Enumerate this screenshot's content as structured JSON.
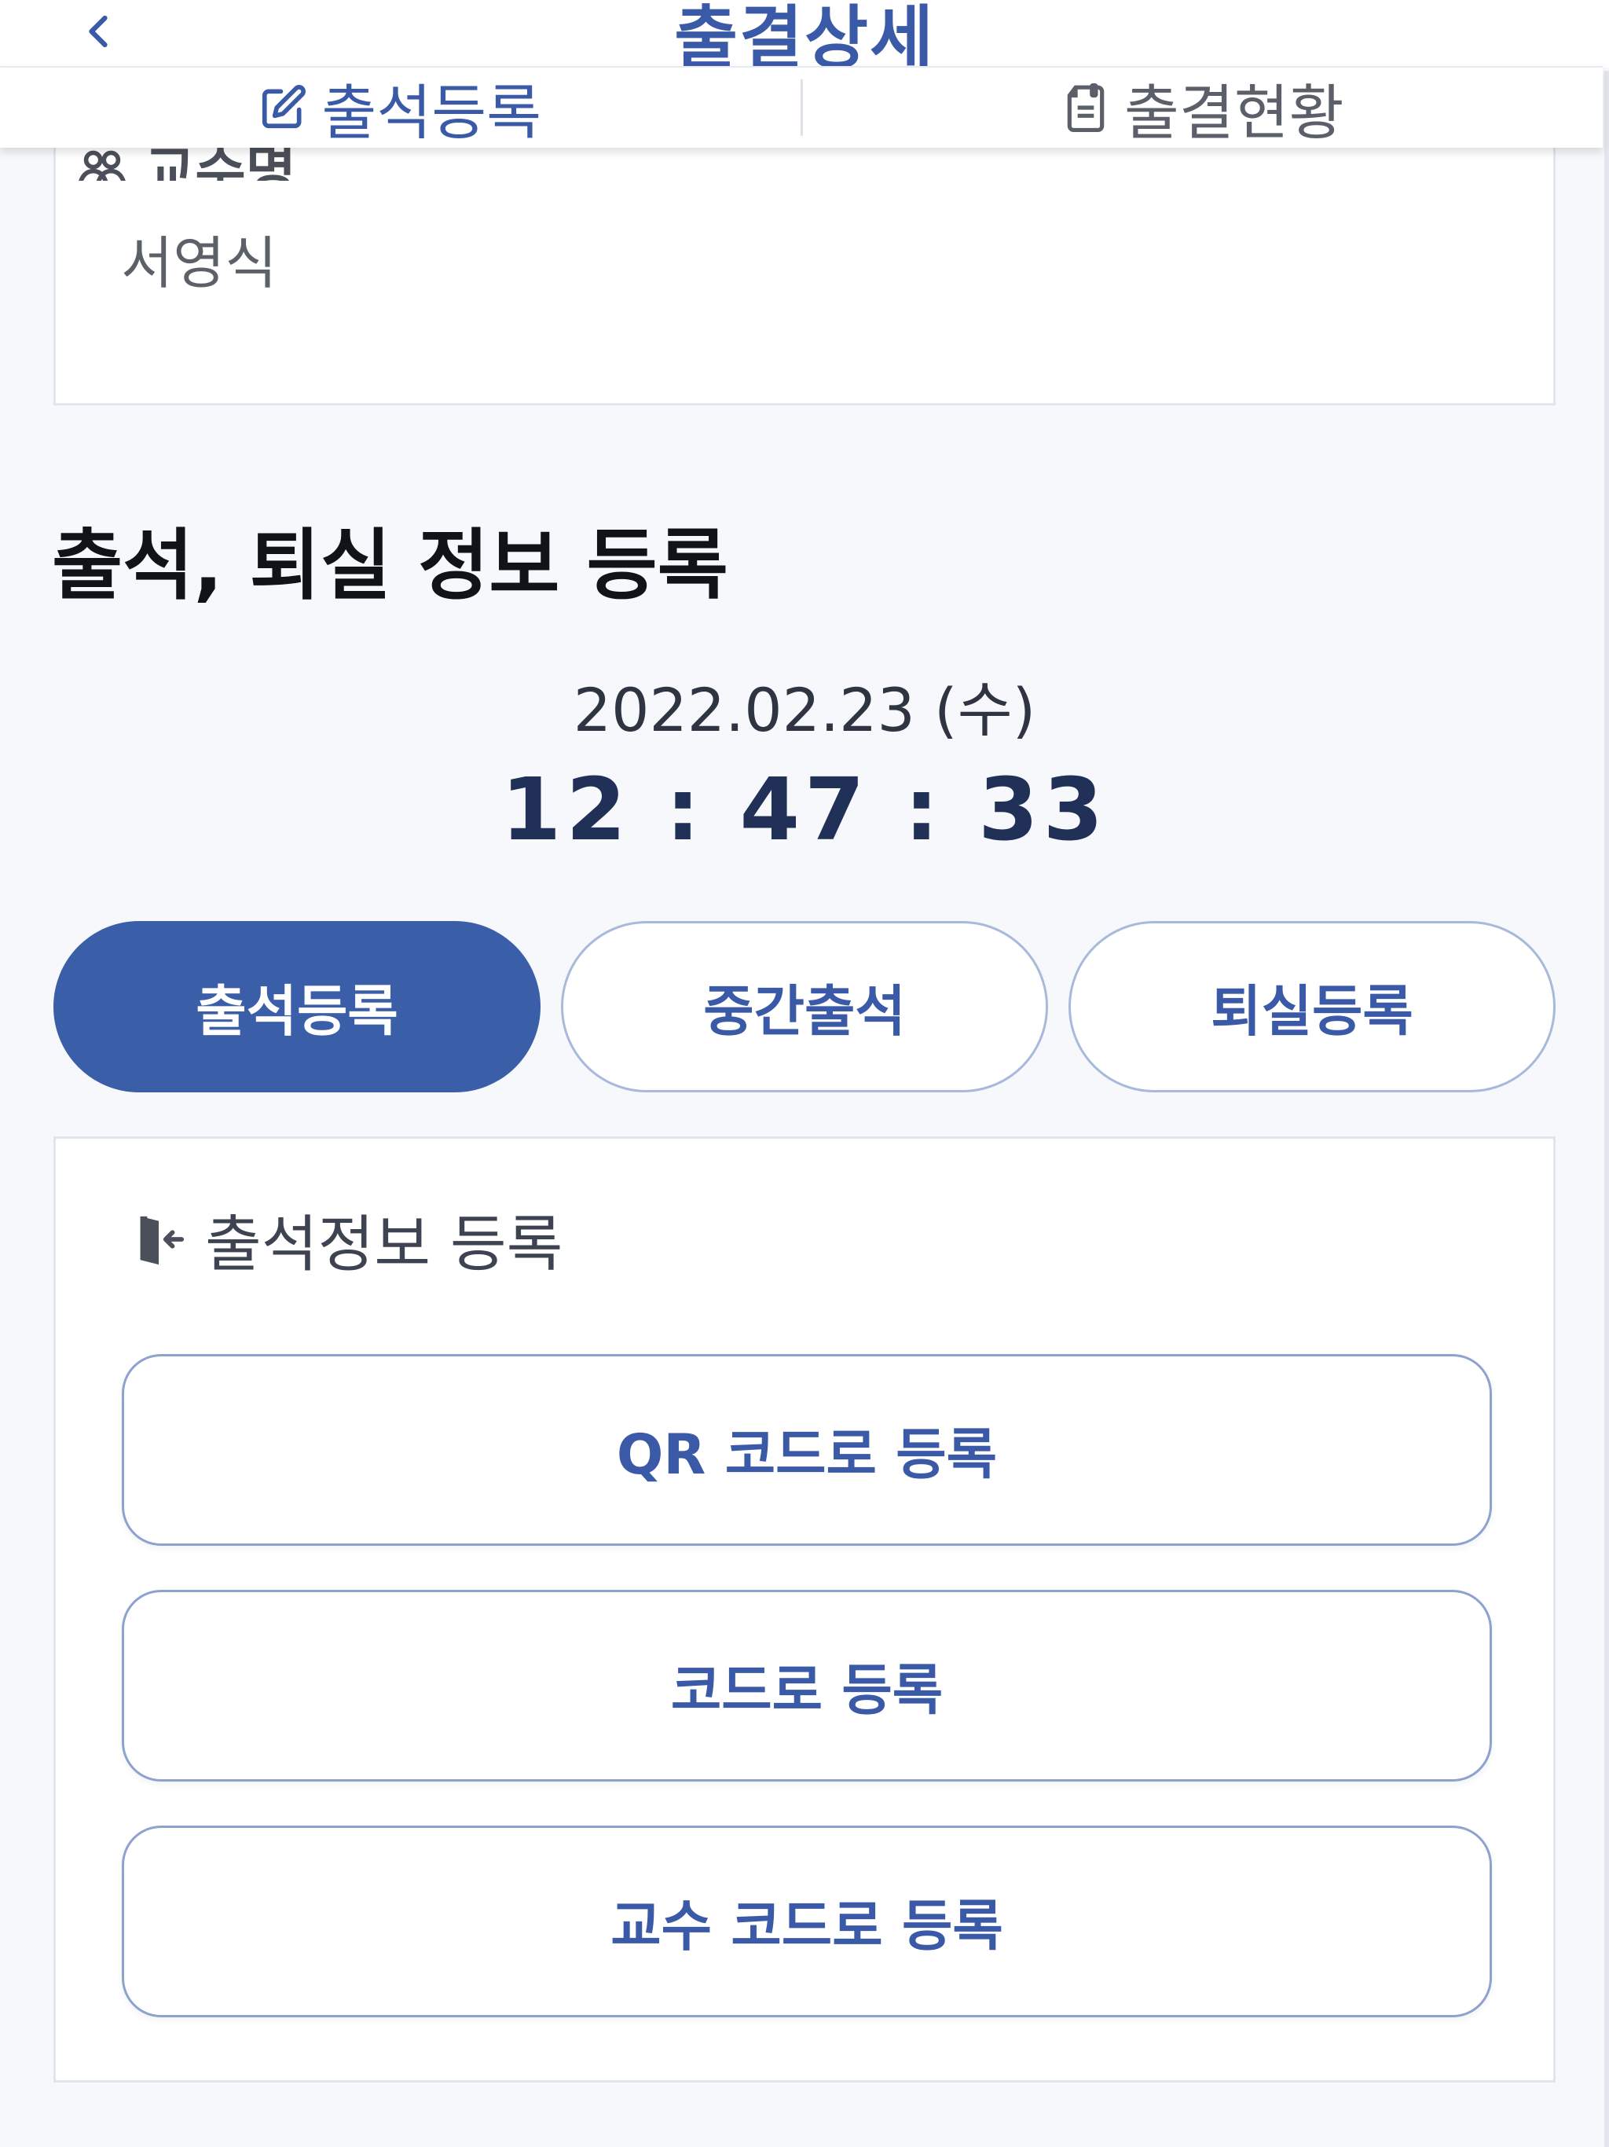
{
  "header": {
    "title": "출결상세",
    "back_icon": "chevron-left-icon"
  },
  "tabs": [
    {
      "label": "출석등록",
      "icon": "edit-icon",
      "active": true
    },
    {
      "label": "출결현황",
      "icon": "document-icon",
      "active": false
    }
  ],
  "info_card": {
    "professor_label": "교수명",
    "professor_icon": "professor-icon",
    "professor_name": "서영식"
  },
  "attendance": {
    "section_title": "출석, 퇴실 정보 등록",
    "date": "2022.02.23 (수)",
    "time": "12 : 47 : 33"
  },
  "segments": [
    {
      "label": "출석등록",
      "active": true
    },
    {
      "label": "중간출석",
      "active": false
    },
    {
      "label": "퇴실등록",
      "active": false
    }
  ],
  "register_card": {
    "heading": "출석정보 등록",
    "heading_icon": "door-enter-icon",
    "buttons": [
      {
        "label": "QR 코드로 등록"
      },
      {
        "label": "코드로 등록"
      },
      {
        "label": "교수 코드로 등록"
      }
    ]
  },
  "colors": {
    "accent": "#3b5ea9",
    "background": "#f6f8fc",
    "card": "#ffffff"
  }
}
